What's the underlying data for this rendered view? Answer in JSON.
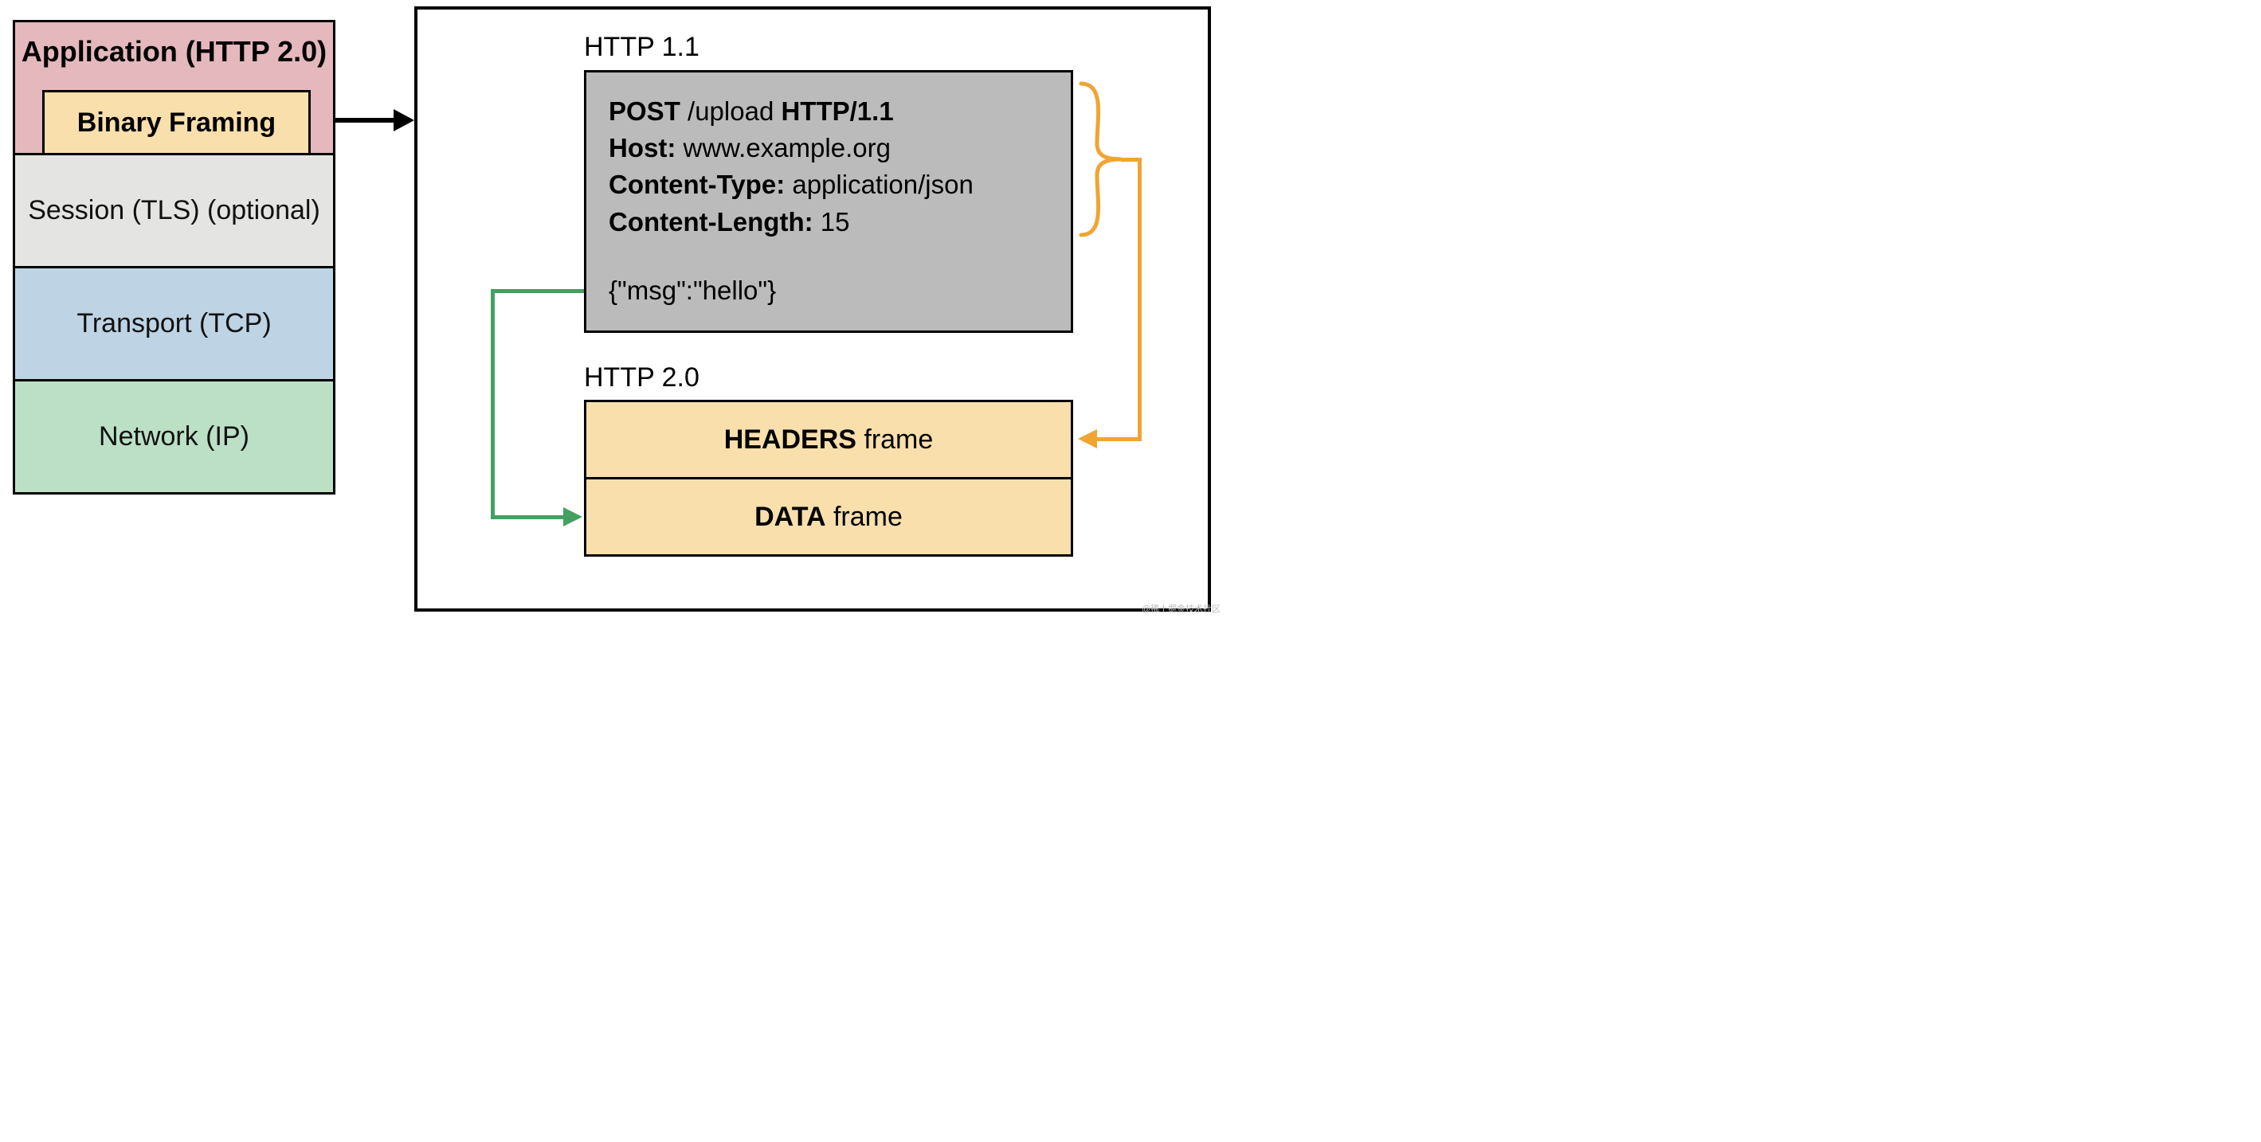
{
  "stack": {
    "app_title": "Application (HTTP 2.0)",
    "binary_framing": "Binary Framing",
    "session": "Session (TLS) (optional)",
    "transport": "Transport (TCP)",
    "network": "Network (IP)"
  },
  "http11": {
    "label": "HTTP 1.1",
    "method": "POST",
    "path": " /upload ",
    "version": "HTTP/1.1",
    "host_key": "Host:",
    "host_val": " www.example.org",
    "ct_key": "Content-Type:",
    "ct_val": " application/json",
    "cl_key": "Content-Length:",
    "cl_val": " 15",
    "body": "{\"msg\":\"hello\"}"
  },
  "http20": {
    "label": "HTTP 2.0",
    "headers_bold": "HEADERS",
    "headers_rest": " frame",
    "data_bold": "DATA",
    "data_rest": " frame"
  },
  "colors": {
    "app": "#e4b8bc",
    "framing": "#f8dfac",
    "session": "#e4e4e2",
    "transport": "#bed4e5",
    "network": "#bce0c6",
    "http11_box": "#bbbbbb",
    "orange": "#f0a432",
    "green": "#43A060"
  },
  "watermark": "@稀土掘金技术社区"
}
